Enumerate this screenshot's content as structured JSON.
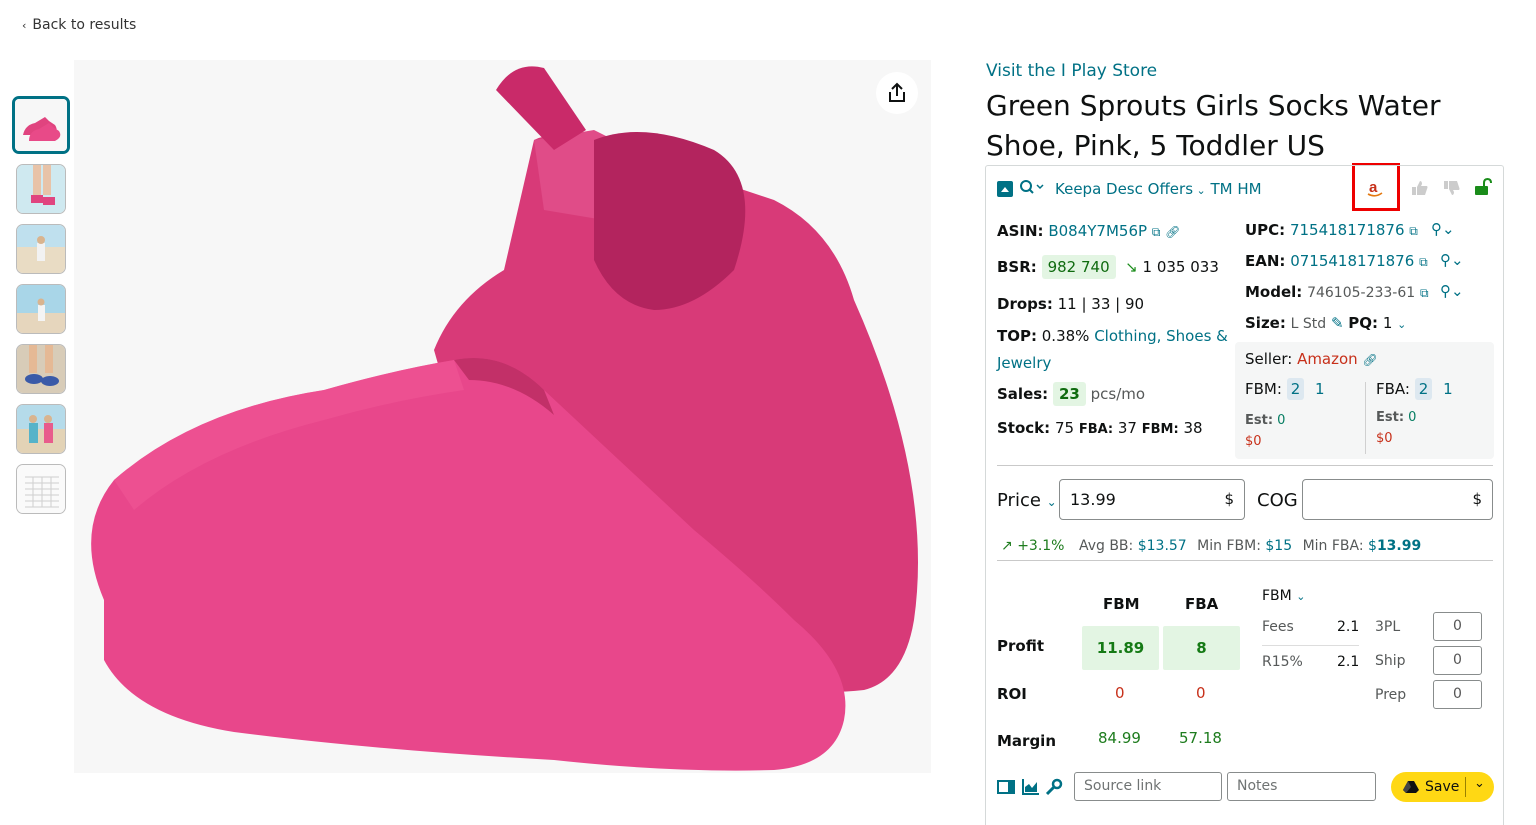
{
  "nav": {
    "back_label": "Back to results"
  },
  "product": {
    "store_link": "Visit the I Play Store",
    "title": "Green Sprouts Girls Socks Water Shoe, Pink, 5 Toddler US"
  },
  "thumbnails": [
    "pink water shoes",
    "child legs in water",
    "toddler on beach",
    "toddler by sea",
    "feet in sand",
    "two children on beach",
    "size chart"
  ],
  "keepa": {
    "header": {
      "desc": "Keepa Desc",
      "offers": "Offers",
      "tm": "TM",
      "hm": "HM"
    },
    "asin_label": "ASIN:",
    "asin": "B084Y7M56P",
    "bsr_label": "BSR:",
    "bsr": "982 740",
    "bsr_prev": "1 035 033",
    "drops_label": "Drops:",
    "drops": "11 | 33 | 90",
    "top_label": "TOP:",
    "top_pct": "0.38%",
    "top_cat": "Clothing, Shoes &",
    "top_cat2": "Jewelry",
    "sales_label": "Sales:",
    "sales": "23",
    "sales_unit": "pcs/mo",
    "stock_label": "Stock:",
    "stock": "75",
    "stock_fba_label": "FBA:",
    "stock_fba": "37",
    "stock_fbm_label": "FBM:",
    "stock_fbm": "38",
    "upc_label": "UPC:",
    "upc": "715418171876",
    "ean_label": "EAN:",
    "ean": "0715418171876",
    "model_label": "Model:",
    "model": "746105-233-61",
    "size_label": "Size:",
    "size": "L Std",
    "pq_label": "PQ:",
    "pq": "1",
    "seller_label": "Seller:",
    "seller": "Amazon",
    "fbm_label": "FBM:",
    "fbm_a": "2",
    "fbm_b": "1",
    "fba_label": "FBA:",
    "fba_a": "2",
    "fba_b": "1",
    "est_label": "Est:",
    "est_fbm": "0",
    "est_fbm_money": "$0",
    "est_fba": "0",
    "est_fba_money": "$0",
    "price_label": "Price",
    "price_value": "13.99",
    "currency": "$",
    "cog_label": "COG",
    "trend": "+3.1%",
    "avg_bb_label": "Avg BB:",
    "avg_bb": "$13.57",
    "min_fbm_label": "Min FBM:",
    "min_fbm": "$15",
    "min_fba_label": "Min FBA:",
    "min_fba_cur": "$",
    "min_fba": "13.99",
    "col_fbm": "FBM",
    "col_fba": "FBA",
    "profit_label": "Profit",
    "profit_fbm": "11.89",
    "profit_fba": "8",
    "roi_label": "ROI",
    "roi_fbm": "0",
    "roi_fba": "0",
    "margin_label": "Margin",
    "margin_fbm": "84.99",
    "margin_fba": "57.18",
    "fee_mode": "FBM",
    "fees_label": "Fees",
    "fees": "2.1",
    "r15_label": "R15%",
    "r15": "2.1",
    "tpl_label": "3PL",
    "tpl": "0",
    "ship_label": "Ship",
    "ship": "0",
    "prep_label": "Prep",
    "prep": "0",
    "source_placeholder": "Source link",
    "notes_placeholder": "Notes",
    "save_label": "Save"
  },
  "colors": {
    "teal": "#007185",
    "green": "#067d62",
    "red": "#c7301a",
    "save": "#ffd814",
    "highlight": "#e00000"
  }
}
